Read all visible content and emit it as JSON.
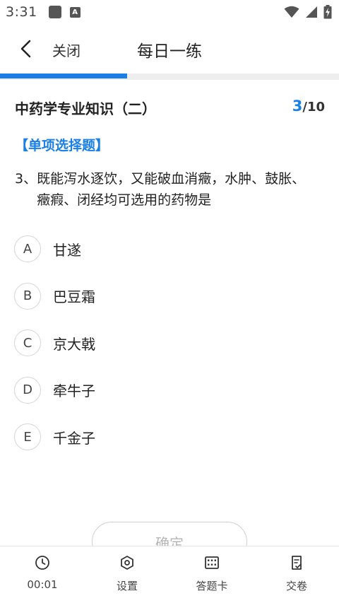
{
  "status_bar": {
    "time": "3:31",
    "icons": [
      "notification-square-icon",
      "app-a-icon",
      "wifi-icon",
      "signal-icon",
      "battery-icon"
    ]
  },
  "nav": {
    "back_icon": "chevron-left-icon",
    "close_label": "关闭",
    "title": "每日一练"
  },
  "progress": {
    "fraction": 0.375,
    "color": "#1a7fe6"
  },
  "question": {
    "subject": "中药学专业知识（二）",
    "current": "3",
    "total": "/10",
    "type": "【单项选择题】",
    "number": "3、",
    "text": "既能泻水逐饮，又能破血消癥，水肿、鼓胀、癥瘕、闭经均可选用的药物是",
    "options": [
      {
        "letter": "A",
        "text": "甘遂"
      },
      {
        "letter": "B",
        "text": "巴豆霜"
      },
      {
        "letter": "C",
        "text": "京大戟"
      },
      {
        "letter": "D",
        "text": "牵牛子"
      },
      {
        "letter": "E",
        "text": "千金子"
      }
    ]
  },
  "confirm_label": "确定",
  "tabs": [
    {
      "icon": "clock-icon",
      "label": "00:01"
    },
    {
      "icon": "hexagon-settings-icon",
      "label": "设置"
    },
    {
      "icon": "grid-card-icon",
      "label": "答题卡"
    },
    {
      "icon": "submit-paper-icon",
      "label": "交卷"
    }
  ],
  "colors": {
    "accent": "#1a7fe6",
    "text": "#222222",
    "muted": "#b5b5b5"
  }
}
